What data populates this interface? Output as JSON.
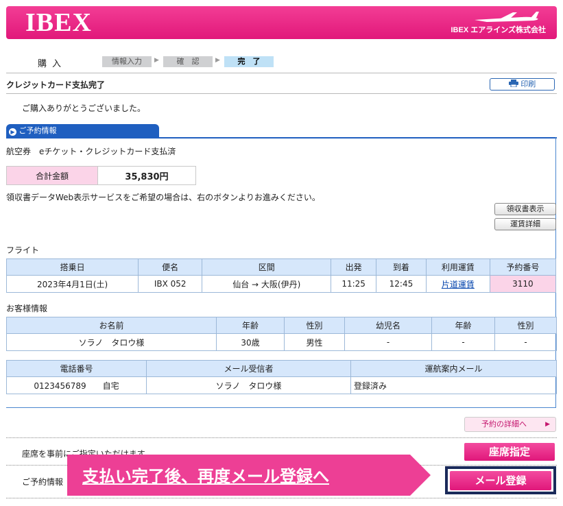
{
  "header": {
    "logo": "IBEX",
    "company": "IBEX エアラインズ株式会社"
  },
  "steps": {
    "label": "購入",
    "items": [
      "情報入力",
      "確　認",
      "完　了"
    ]
  },
  "page_title": "クレジットカード支払完了",
  "print_label": "印刷",
  "thanks": "ご購入ありがとうございました。",
  "reservation_tab": "ご予約情報",
  "ticket_type": "航空券　eチケット・クレジットカード支払済",
  "total": {
    "label": "合計金額",
    "value": "35,830円"
  },
  "receipt_note": "領収書データWeb表示サービスをご希望の場合は、右のボタンよりお進みください。",
  "receipt_button": "領収書表示",
  "fare_button": "運賃詳細",
  "flight": {
    "section": "フライト",
    "headers": [
      "搭乗日",
      "便名",
      "区間",
      "出発",
      "到着",
      "利用運賃",
      "予約番号"
    ],
    "row": [
      "2023年4月1日(土)",
      "IBX 052",
      "仙台 → 大阪(伊丹)",
      "11:25",
      "12:45",
      "片道運賃",
      "3110"
    ]
  },
  "customer": {
    "section": "お客様情報",
    "headers": [
      "お名前",
      "年齢",
      "性別",
      "幼児名",
      "年齢",
      "性別"
    ],
    "row": [
      "ソラノ　タロウ様",
      "30歳",
      "男性",
      "-",
      "-",
      "-"
    ]
  },
  "contact": {
    "headers": [
      "電話番号",
      "メール受信者",
      "運航案内メール"
    ],
    "row": [
      "0123456789　　自宅",
      "ソラノ　タロウ様",
      "登録済み"
    ]
  },
  "reservation_detail_button": "予約の詳細へ",
  "seat_note": "座席を事前にご指定いただけます。",
  "seat_button": "座席指定",
  "reservation_note": "ご予約情報",
  "mail_button": "メール登録",
  "banner_text": "支払い完了後、再度メール登録へ",
  "colors": {
    "brand_pink": "#e81f80",
    "accent_blue": "#1f5fc0",
    "highlight_navy": "#1a2a5a"
  },
  "icons": [
    "plane-icon",
    "printer-icon",
    "circle-arrow-icon",
    "chevron-right-icon"
  ]
}
